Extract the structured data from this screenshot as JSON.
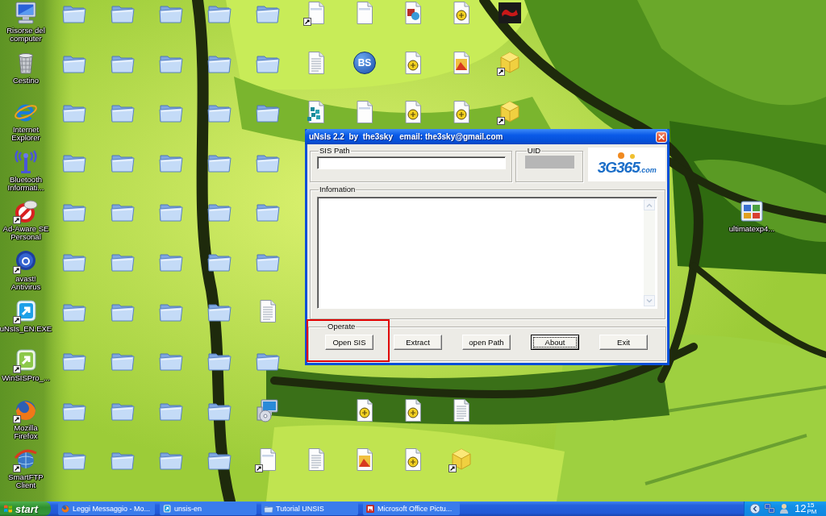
{
  "desktop": {
    "icon_rows": [
      {
        "icons": [
          {
            "kind": "computer",
            "label": "Risorse del computer"
          },
          {
            "kind": "folder"
          },
          {
            "kind": "folder"
          },
          {
            "kind": "folder"
          },
          {
            "kind": "folder"
          },
          {
            "kind": "folder"
          },
          {
            "kind": "shortcut-page"
          },
          {
            "kind": "page"
          },
          {
            "kind": "picture-page"
          },
          {
            "kind": "emblem-page"
          },
          {
            "kind": "logo-tile"
          }
        ]
      },
      {
        "icons": [
          {
            "kind": "trash",
            "label": "Cestino"
          },
          {
            "kind": "folder"
          },
          {
            "kind": "folder"
          },
          {
            "kind": "folder"
          },
          {
            "kind": "folder"
          },
          {
            "kind": "folder"
          },
          {
            "kind": "text-page"
          },
          {
            "kind": "badge",
            "glyph": "BS"
          },
          {
            "kind": "emblem-page"
          },
          {
            "kind": "photo-page"
          },
          {
            "kind": "cube"
          }
        ]
      },
      {
        "icons": [
          {
            "kind": "ie",
            "label": "Internet Explorer"
          },
          {
            "kind": "folder"
          },
          {
            "kind": "folder"
          },
          {
            "kind": "folder"
          },
          {
            "kind": "folder"
          },
          {
            "kind": "folder"
          },
          {
            "kind": "cubes-page"
          },
          {
            "kind": "page"
          },
          {
            "kind": "emblem-page"
          },
          {
            "kind": "emblem-page"
          },
          {
            "kind": "cube"
          }
        ]
      },
      {
        "icons": [
          {
            "kind": "bluetooth",
            "label": "Bluetooth Informati..."
          },
          {
            "kind": "folder"
          },
          {
            "kind": "folder"
          },
          {
            "kind": "folder"
          },
          {
            "kind": "folder"
          },
          {
            "kind": "folder"
          }
        ]
      },
      {
        "icons": [
          {
            "kind": "adaware",
            "label": "Ad-Aware SE Personal"
          },
          {
            "kind": "folder"
          },
          {
            "kind": "folder"
          },
          {
            "kind": "folder"
          },
          {
            "kind": "folder"
          },
          {
            "kind": "folder"
          },
          {
            "kind": "window-tiles",
            "label": "ultimatexp4..."
          }
        ]
      },
      {
        "icons": [
          {
            "kind": "avast",
            "label": "avast! Antivirus"
          },
          {
            "kind": "folder"
          },
          {
            "kind": "folder"
          },
          {
            "kind": "folder"
          },
          {
            "kind": "folder"
          },
          {
            "kind": "folder"
          }
        ]
      },
      {
        "icons": [
          {
            "kind": "unsis",
            "label": "uNsIs_EN.EXE"
          },
          {
            "kind": "folder"
          },
          {
            "kind": "folder"
          },
          {
            "kind": "folder"
          },
          {
            "kind": "folder"
          },
          {
            "kind": "text-page"
          }
        ]
      },
      {
        "icons": [
          {
            "kind": "winsis",
            "label": "WinSISPro_..."
          },
          {
            "kind": "folder"
          },
          {
            "kind": "folder"
          },
          {
            "kind": "folder"
          },
          {
            "kind": "folder"
          },
          {
            "kind": "folder"
          }
        ]
      },
      {
        "icons": [
          {
            "kind": "firefox",
            "label": "Mozilla Firefox"
          },
          {
            "kind": "folder"
          },
          {
            "kind": "folder"
          },
          {
            "kind": "folder"
          },
          {
            "kind": "folder"
          },
          {
            "kind": "installer"
          },
          {
            "kind": "emblem-page"
          },
          {
            "kind": "emblem-page"
          },
          {
            "kind": "text-page"
          }
        ]
      },
      {
        "icons": [
          {
            "kind": "smartftp",
            "label": "SmartFTP Client"
          },
          {
            "kind": "folder"
          },
          {
            "kind": "folder"
          },
          {
            "kind": "folder"
          },
          {
            "kind": "folder"
          },
          {
            "kind": "shortcut-page"
          },
          {
            "kind": "text-page"
          },
          {
            "kind": "photo-page"
          },
          {
            "kind": "emblem-page"
          },
          {
            "kind": "cube"
          }
        ]
      }
    ]
  },
  "dialog": {
    "title": "uNsIs 2.2  by  the3sky   email: the3sky@gmail.com",
    "sis_path": {
      "label": "SIS Path"
    },
    "uid": {
      "label": "UID",
      "disabled": true
    },
    "logo": {
      "text": "3G365",
      "suffix": ".com"
    },
    "information": {
      "label": "Infomation"
    },
    "operate": {
      "label": "Operate",
      "buttons": [
        {
          "label": "Open SIS",
          "focused": false,
          "highlighted": true
        },
        {
          "label": "Extract",
          "focused": false,
          "highlighted": false
        },
        {
          "label": "open Path",
          "focused": false,
          "highlighted": false
        },
        {
          "label": "About",
          "focused": true,
          "highlighted": false
        },
        {
          "label": "Exit",
          "focused": false,
          "highlighted": false
        }
      ]
    }
  },
  "taskbar": {
    "start": "start",
    "tasks": [
      {
        "kind": "firefox",
        "label": "Leggi Messaggio - Mo..."
      },
      {
        "kind": "app",
        "label": "unsis-en"
      },
      {
        "kind": "folder",
        "label": "Tutorial UNSIS"
      },
      {
        "kind": "picture",
        "label": "Microsoft Office Pictu..."
      }
    ],
    "tray_icons": [
      {
        "kind": "chevron"
      },
      {
        "kind": "network"
      },
      {
        "kind": "user"
      }
    ],
    "clock": {
      "hour": "12",
      "minute": "15",
      "period": "PM"
    }
  }
}
